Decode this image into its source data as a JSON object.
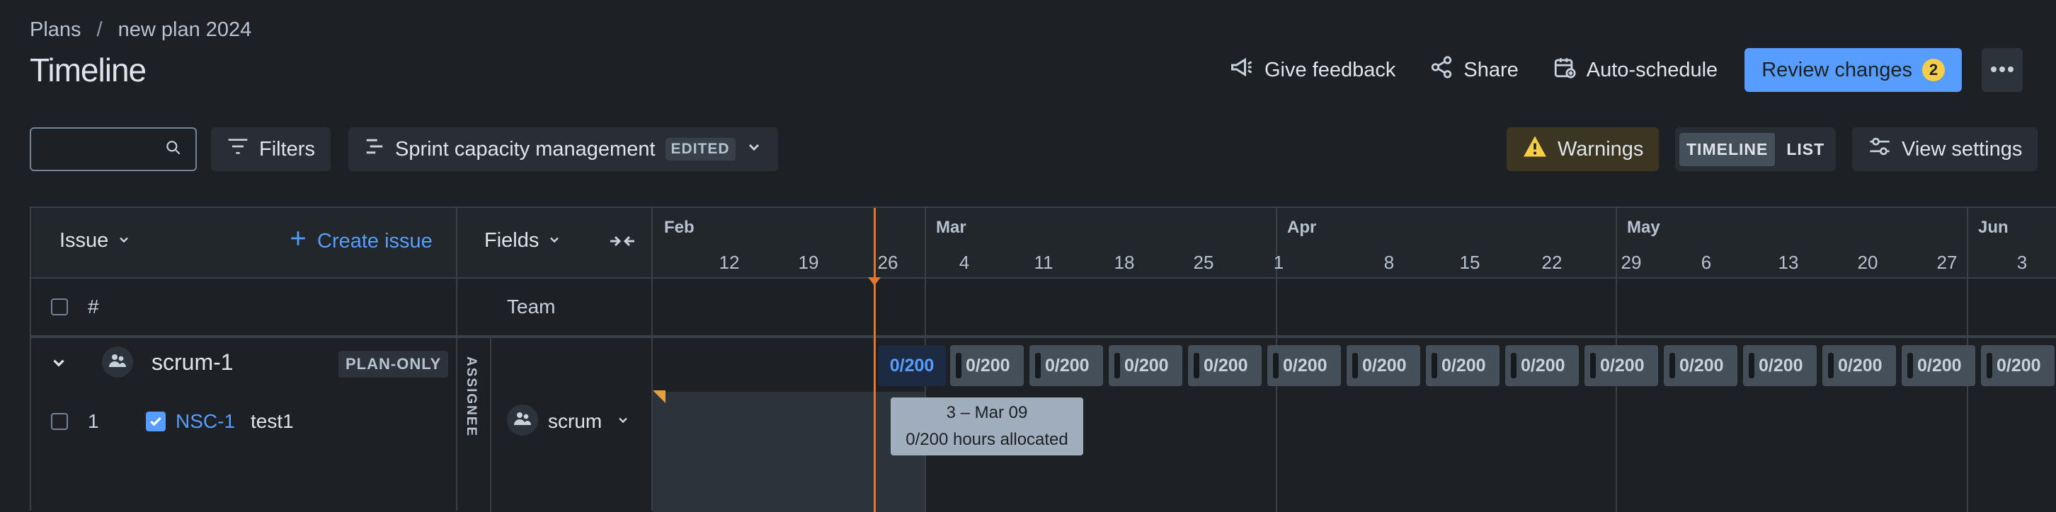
{
  "breadcrumb": {
    "parent": "Plans",
    "separator": "/",
    "current": "new plan 2024"
  },
  "page": {
    "title": "Timeline"
  },
  "header_actions": {
    "feedback": "Give feedback",
    "share": "Share",
    "autoschedule": "Auto-schedule",
    "review": "Review changes",
    "review_count": "2"
  },
  "toolbar": {
    "search_placeholder": "",
    "filters": "Filters",
    "view_name": "Sprint capacity management",
    "edited_badge": "EDITED",
    "warnings": "Warnings",
    "segment_timeline": "TIMELINE",
    "segment_list": "LIST",
    "view_settings": "View settings"
  },
  "issue_panel": {
    "header": "Issue",
    "create": "Create issue",
    "col_hash": "#",
    "group_name": "scrum-1",
    "group_badge": "PLAN-ONLY",
    "row_number": "1",
    "issue_key": "NSC-1",
    "issue_summary": "test1"
  },
  "fields_panel": {
    "header": "Fields",
    "col_team": "Team",
    "vertical_label": "ASSIGNEE",
    "team_value": "scrum"
  },
  "timeline": {
    "months": [
      "Feb",
      "Mar",
      "Apr",
      "May",
      "Jun"
    ],
    "weeks": [
      "12",
      "19",
      "26",
      "4",
      "11",
      "18",
      "25",
      "1",
      "8",
      "15",
      "22",
      "29",
      "6",
      "13",
      "20",
      "27",
      "3"
    ],
    "capacity_labels": [
      "0/200",
      "0/200",
      "0/200",
      "0/200",
      "0/200",
      "0/200",
      "0/200",
      "0/200",
      "0/200",
      "0/200",
      "0/200",
      "0/200",
      "0/200",
      "0/200",
      "0/200"
    ],
    "tooltip_dates": "3 – Mar 09",
    "tooltip_hours": "0/200 hours allocated"
  },
  "colors": {
    "accent": "#579dff",
    "today": "#e2762e",
    "badge": "#f5cd47"
  }
}
